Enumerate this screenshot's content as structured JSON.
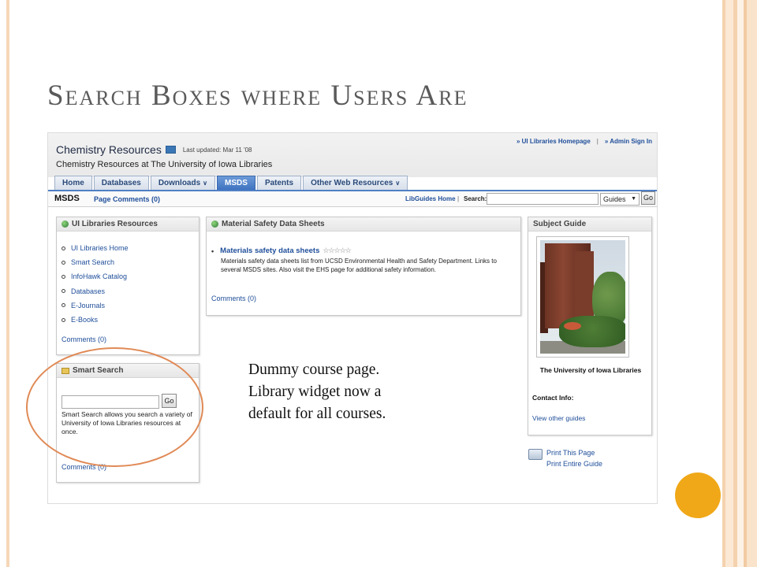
{
  "slide": {
    "title": "Search Boxes where Users Are",
    "annotation_lines": [
      "Dummy course page.",
      "Library widget now a",
      "default for all courses."
    ]
  },
  "guide": {
    "title": "Chemistry Resources",
    "last_updated": "Last updated: Mar 11 '08",
    "subtitle": "Chemistry Resources at The University of Iowa Libraries",
    "top_links": [
      "» UI Libraries Homepage",
      "|",
      "» Admin Sign In"
    ],
    "tabs": [
      {
        "label": "Home",
        "dropdown": false,
        "active": false
      },
      {
        "label": "Databases",
        "dropdown": false,
        "active": false
      },
      {
        "label": "Downloads",
        "dropdown": true,
        "active": false
      },
      {
        "label": "MSDS",
        "dropdown": false,
        "active": true
      },
      {
        "label": "Patents",
        "dropdown": false,
        "active": false
      },
      {
        "label": "Other Web Resources",
        "dropdown": true,
        "active": false
      }
    ],
    "page_bar": {
      "page_name": "MSDS",
      "page_comments": "Page Comments (0)",
      "libguides_home": "LibGuides Home",
      "separator": "|",
      "search_label": "Search:",
      "search_value": "",
      "select_value": "Guides",
      "go_label": "Go"
    },
    "resources_box": {
      "title": "UI Libraries Resources",
      "items": [
        "UI Libraries Home",
        "Smart Search",
        "InfoHawk Catalog",
        "Databases",
        "E-Journals",
        "E-Books"
      ],
      "comments": "Comments (0)"
    },
    "smart_search_box": {
      "title": "Smart Search",
      "input_value": "",
      "go_label": "Go",
      "description": "Smart Search allows you search a variety of University of Iowa Libraries resources at once.",
      "comments": "Comments (0)"
    },
    "msds_box": {
      "title": "Material Safety Data Sheets",
      "bullet": "•",
      "link_title": "Materials safety data sheets",
      "stars": "☆☆☆☆☆",
      "description": "Materials safety data sheets list from UCSD Environmental Health and Safety Department. Links to several MSDS sites. Also visit the EHS page for additional safety information.",
      "comments": "Comments (0)"
    },
    "subject_guide": {
      "title": "Subject Guide",
      "name": "The University of Iowa Libraries",
      "contact": "Contact Info:",
      "other_guides": "View other guides"
    },
    "print_links": [
      "Print This Page",
      "Print Entire Guide"
    ]
  },
  "colors": {
    "link": "#1f4e9a",
    "active_tab": "#3f73c0",
    "highlight_ellipse": "#e08a56",
    "accent_circle": "#f0a818"
  },
  "icons": {
    "guide_title": "rss-icon",
    "box_globe": "globe-icon",
    "smart_search": "folder-icon",
    "print": "printer-icon"
  }
}
